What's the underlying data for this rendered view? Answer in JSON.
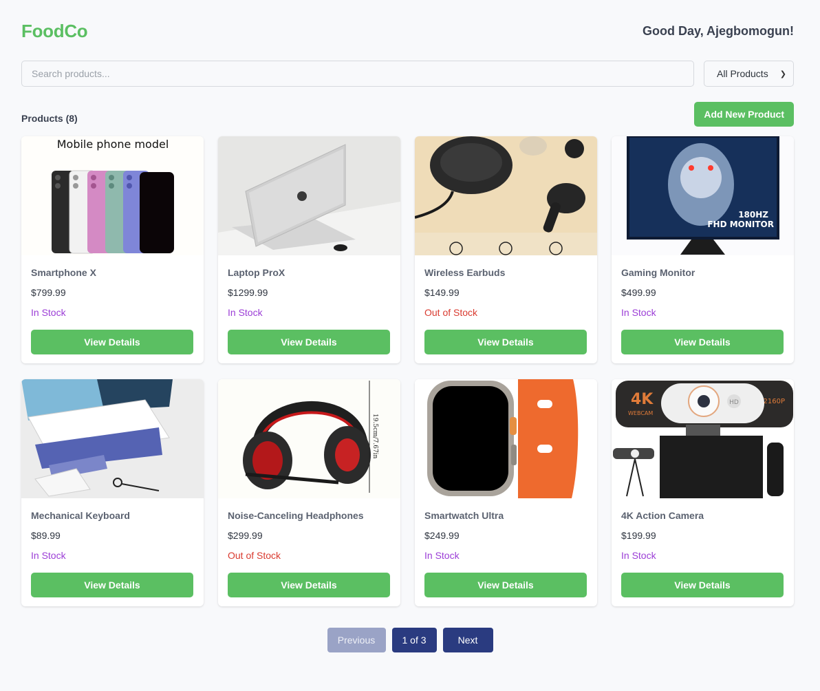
{
  "header": {
    "logo": "FoodCo",
    "greeting": "Good Day, Ajegbomogun!"
  },
  "search": {
    "placeholder": "Search products...",
    "filter_selected": "All Products"
  },
  "toolbar": {
    "products_count": "Products (8)",
    "add_button": "Add New Product"
  },
  "colors": {
    "brand_green": "#5bbf62",
    "in_stock": "#9b3dd6",
    "out_of_stock": "#d93a2f",
    "pagination_navy": "#2a3b80"
  },
  "products": [
    {
      "name": "Smartphone X",
      "price": "$799.99",
      "stock": "In Stock",
      "button": "View Details",
      "image_caption": "Mobile phone model"
    },
    {
      "name": "Laptop ProX",
      "price": "$1299.99",
      "stock": "In Stock",
      "button": "View Details"
    },
    {
      "name": "Wireless Earbuds",
      "price": "$149.99",
      "stock": "Out of Stock",
      "button": "View Details"
    },
    {
      "name": "Gaming Monitor",
      "price": "$499.99",
      "stock": "In Stock",
      "button": "View Details",
      "image_caption": "FHD MONITOR",
      "image_badge": "180HZ"
    },
    {
      "name": "Mechanical Keyboard",
      "price": "$89.99",
      "stock": "In Stock",
      "button": "View Details"
    },
    {
      "name": "Noise-Canceling Headphones",
      "price": "$299.99",
      "stock": "Out of Stock",
      "button": "View Details",
      "image_caption": "19.5cm/7.67in"
    },
    {
      "name": "Smartwatch Ultra",
      "price": "$249.99",
      "stock": "In Stock",
      "button": "View Details"
    },
    {
      "name": "4K Action Camera",
      "price": "$199.99",
      "stock": "In Stock",
      "button": "View Details",
      "image_caption": "4K",
      "image_sub": "WEBCAM",
      "image_hd": "HD",
      "image_badge": "HD 2160P"
    }
  ],
  "pagination": {
    "previous": "Previous",
    "current": "1 of 3",
    "next": "Next"
  }
}
